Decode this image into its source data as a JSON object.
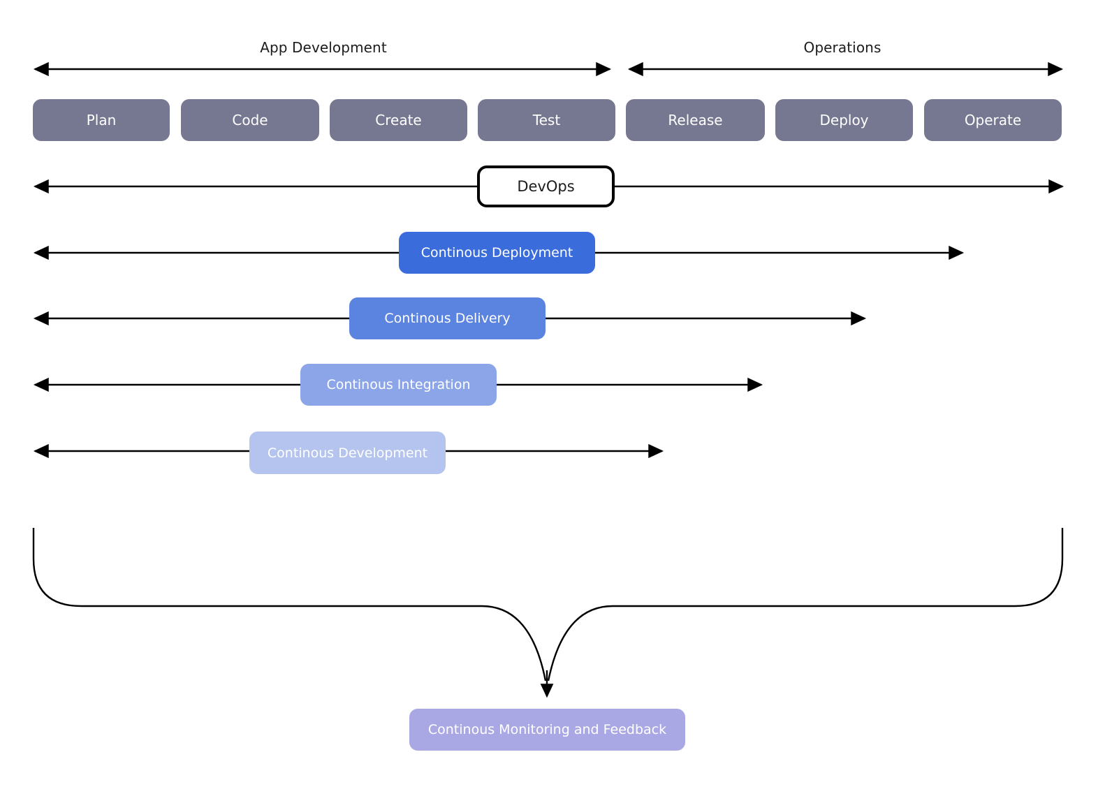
{
  "diagram": {
    "title_lanes": [
      {
        "label": "App Development"
      },
      {
        "label": "Operations"
      }
    ],
    "stages": [
      {
        "label": "Plan"
      },
      {
        "label": "Code"
      },
      {
        "label": "Create"
      },
      {
        "label": "Test"
      },
      {
        "label": "Release"
      },
      {
        "label": "Deploy"
      },
      {
        "label": "Operate"
      }
    ],
    "devops": {
      "label": "DevOps"
    },
    "practices": [
      {
        "label": "Continous Deployment",
        "color": "#3a6cdc"
      },
      {
        "label": "Continous Delivery",
        "color": "#5b83e0"
      },
      {
        "label": "Continous Integration",
        "color": "#8ba5e8"
      },
      {
        "label": "Continous Development",
        "color": "#b4c4ef"
      }
    ],
    "feedback": {
      "label": "Continous Monitoring and Feedback",
      "color": "#aaa8e4"
    },
    "colors": {
      "stage_fill": "#767790",
      "line": "#000000",
      "text_light": "#ffffff",
      "text_dark": "#1c1c1c",
      "background": "#ffffff"
    }
  }
}
